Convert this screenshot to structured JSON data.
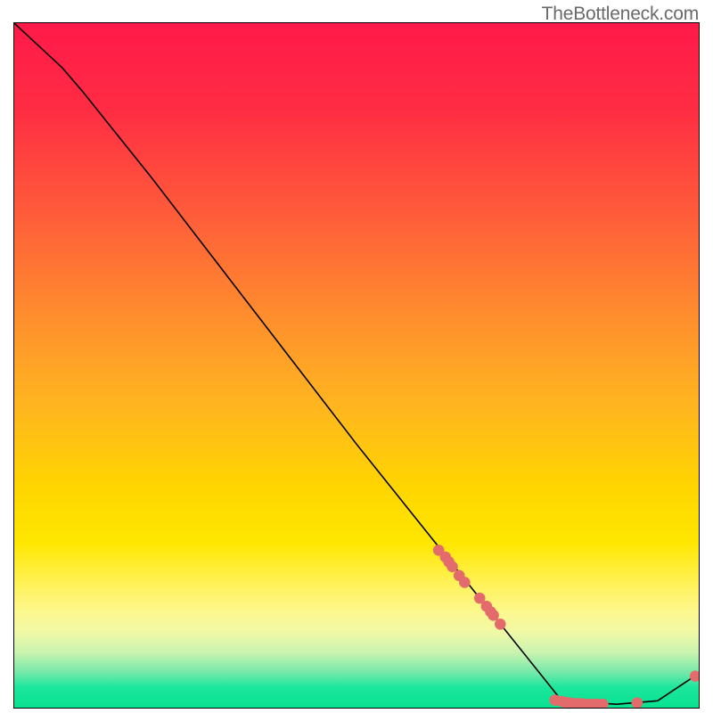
{
  "watermark": "TheBottleneck.com",
  "chart_data": {
    "type": "line",
    "title": "",
    "xlabel": "",
    "ylabel": "",
    "xlim": [
      0,
      100
    ],
    "ylim": [
      0,
      100
    ],
    "curve": [
      {
        "x": 0,
        "y": 100
      },
      {
        "x": 7,
        "y": 93.5
      },
      {
        "x": 10,
        "y": 90
      },
      {
        "x": 20,
        "y": 77.5
      },
      {
        "x": 30,
        "y": 64.5
      },
      {
        "x": 40,
        "y": 51.5
      },
      {
        "x": 50,
        "y": 38.5
      },
      {
        "x": 60,
        "y": 26
      },
      {
        "x": 70,
        "y": 13.5
      },
      {
        "x": 80,
        "y": 1
      },
      {
        "x": 88,
        "y": 0.5
      },
      {
        "x": 94,
        "y": 1
      },
      {
        "x": 100,
        "y": 5
      }
    ],
    "dot_cluster_1": [
      {
        "x": 62,
        "y": 23
      },
      {
        "x": 63,
        "y": 22
      },
      {
        "x": 63.5,
        "y": 21.3
      },
      {
        "x": 64,
        "y": 20.6
      },
      {
        "x": 65,
        "y": 19.3
      },
      {
        "x": 65.8,
        "y": 18.3
      },
      {
        "x": 68,
        "y": 16
      },
      {
        "x": 69,
        "y": 14.8
      },
      {
        "x": 69.6,
        "y": 14.0
      },
      {
        "x": 70,
        "y": 13.5
      },
      {
        "x": 71,
        "y": 12.2
      }
    ],
    "dot_cluster_2": [
      {
        "x": 79,
        "y": 1.1
      },
      {
        "x": 80,
        "y": 0.9
      },
      {
        "x": 80.6,
        "y": 0.75
      },
      {
        "x": 81.2,
        "y": 0.7
      },
      {
        "x": 82,
        "y": 0.6
      },
      {
        "x": 82.6,
        "y": 0.6
      },
      {
        "x": 83.2,
        "y": 0.55
      },
      {
        "x": 84,
        "y": 0.5
      },
      {
        "x": 84.6,
        "y": 0.5
      },
      {
        "x": 85.2,
        "y": 0.5
      },
      {
        "x": 86,
        "y": 0.5
      },
      {
        "x": 91,
        "y": 0.7
      },
      {
        "x": 99.5,
        "y": 4.6
      }
    ],
    "colors": {
      "line": "#000000",
      "dots": "#e46b6b"
    }
  }
}
